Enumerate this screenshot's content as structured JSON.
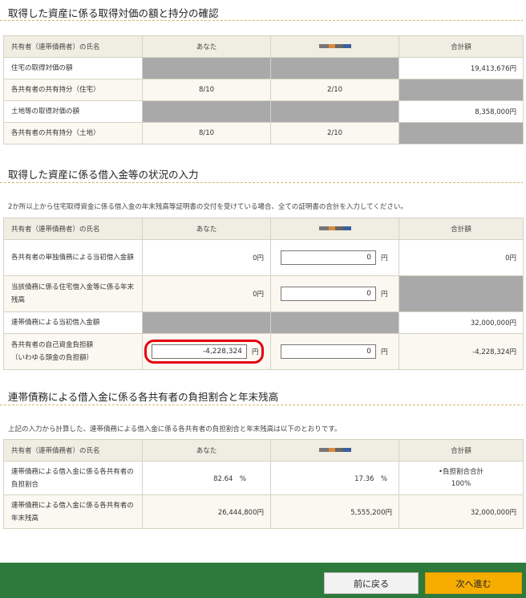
{
  "section1": {
    "title": "取得した資産に係る取得対価の額と持分の確認",
    "headers": [
      "共有者（連帯債務者）の氏名",
      "あなた",
      "",
      "合計額"
    ],
    "rows": [
      {
        "label": "住宅の取得対価の額",
        "you": "",
        "other": "",
        "total": "19,413,676円"
      },
      {
        "label": "各共有者の共有持分（住宅）",
        "you": "8/10",
        "other": "2/10",
        "total": ""
      },
      {
        "label": "土地等の取得対価の額",
        "you": "",
        "other": "",
        "total": "8,358,000円"
      },
      {
        "label": "各共有者の共有持分（土地）",
        "you": "8/10",
        "other": "2/10",
        "total": ""
      }
    ]
  },
  "section2": {
    "title": "取得した資産に係る借入金等の状況の入力",
    "note": "2か所以上から住宅取得資金に係る借入金の年末残高等証明書の交付を受けている場合、全ての証明書の合計を入力してください。",
    "headers": [
      "共有者（連帯債務者）の氏名",
      "あなた",
      "",
      "合計額"
    ],
    "unit": "円",
    "rows": [
      {
        "label": "各共有者の単独債務による当初借入金額",
        "you": "0円",
        "other_input": "0",
        "total": "0円"
      },
      {
        "label": "当該債務に係る住宅借入金等に係る年末残高",
        "you": "0円",
        "other_input": "0",
        "total": ""
      },
      {
        "label": "連帯債務による当初借入金額",
        "you": "",
        "other": "",
        "total": "32,000,000円"
      },
      {
        "label": "各共有者の自己資金負担額\n（いわゆる頭金の負担額）",
        "you_input": "-4,228,324",
        "other_input": "0",
        "total": "-4,228,324円"
      }
    ]
  },
  "section3": {
    "title": "連帯債務による借入金に係る各共有者の負担割合と年末残高",
    "note": "上記の入力から計算した、連帯債務による借入金に係る各共有者の負担割合と年末残高は以下のとおりです。",
    "headers": [
      "共有者（連帯債務者）の氏名",
      "あなた",
      "",
      "合計額"
    ],
    "rows": [
      {
        "label": "連帯債務による借入金に係る各共有者の負担割合",
        "you": "82.64　%",
        "other": "17.36　%",
        "total_line1": "•負担割合合計",
        "total_line2": "100%"
      },
      {
        "label": "連帯債務による借入金に係る各共有者の年末残高",
        "you": "26,444,800円",
        "other": "5,555,200円",
        "total": "32,000,000円"
      }
    ]
  },
  "footer": {
    "back_label": "前に戻る",
    "next_label": "次へ進む"
  },
  "colors": {
    "footer_bg": "#2d7a3c",
    "next_button": "#f6ad00",
    "gray_cell": "#a9a9a9",
    "highlight": "#e60012"
  }
}
